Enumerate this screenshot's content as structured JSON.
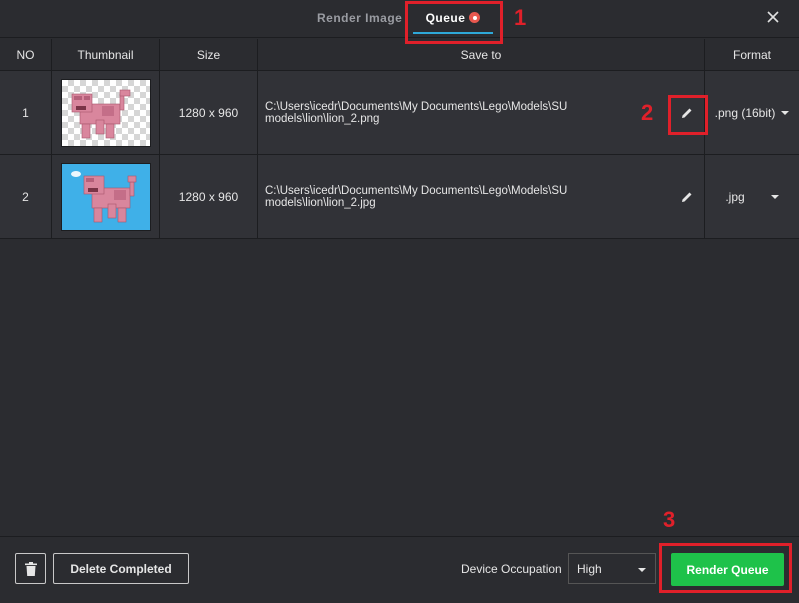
{
  "tabs": {
    "render_image": "Render Image",
    "queue": "Queue"
  },
  "table": {
    "headers": {
      "no": "NO",
      "thumbnail": "Thumbnail",
      "size": "Size",
      "save_to": "Save to",
      "format": "Format"
    },
    "rows": [
      {
        "no": "1",
        "size": "1280 x 960",
        "path": "C:\\Users\\icedr\\Documents\\My Documents\\Lego\\Models\\SU models\\lion\\lion_2.png",
        "format": ".png (16bit)",
        "thumbnail_background": "transparent-checker"
      },
      {
        "no": "2",
        "size": "1280 x 960",
        "path": "C:\\Users\\icedr\\Documents\\My Documents\\Lego\\Models\\SU models\\lion\\lion_2.jpg",
        "format": ".jpg",
        "thumbnail_background": "#3fb0e8"
      }
    ]
  },
  "footer": {
    "delete_completed": "Delete Completed",
    "device_occupation_label": "Device Occupation",
    "device_occupation_value": "High",
    "render_queue": "Render Queue"
  },
  "annotations": [
    "1",
    "2",
    "3"
  ],
  "colors": {
    "accent": "#2ea8d8",
    "render_button": "#1ec24a",
    "annotation": "#e0202a",
    "queue_dot": "#e8584f"
  },
  "icons": [
    "close-icon",
    "edit-icon",
    "trash-icon",
    "chevron-down-icon",
    "lego-lion-thumbnail"
  ]
}
